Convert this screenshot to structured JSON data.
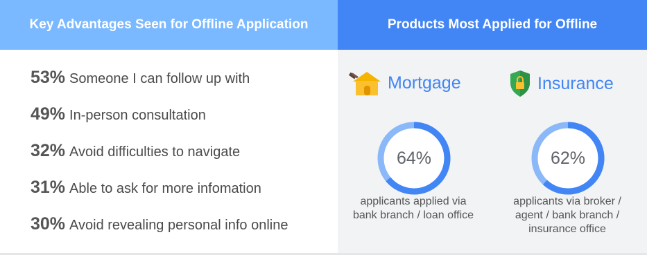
{
  "headers": {
    "left": "Key Advantages Seen for Offline Application",
    "right": "Products Most Applied for Offline"
  },
  "advantages": [
    {
      "pct": "53%",
      "text": "Someone I can follow up with"
    },
    {
      "pct": "49%",
      "text": "In-person consultation"
    },
    {
      "pct": "32%",
      "text": "Avoid difficulties to navigate"
    },
    {
      "pct": "31%",
      "text": "Able to ask for more infomation"
    },
    {
      "pct": "30%",
      "text": "Avoid revealing personal info online"
    }
  ],
  "products": [
    {
      "name": "Mortgage",
      "icon": "house-gavel-icon",
      "label": "64%",
      "caption": "applicants applied via bank branch / loan office"
    },
    {
      "name": "Insurance",
      "icon": "shield-lock-icon",
      "label": "62%",
      "caption": "applicants via broker / agent / bank branch / insurance office"
    }
  ],
  "colors": {
    "left_header": "#7ab8ff",
    "right_header": "#4285f4",
    "donut_fill": "#4285f4",
    "donut_track": "#8ab8f8"
  },
  "chart_data": [
    {
      "type": "bar",
      "title": "Key Advantages Seen for Offline Application",
      "categories": [
        "Someone I can follow up with",
        "In-person consultation",
        "Avoid difficulties to navigate",
        "Able to ask for more infomation",
        "Avoid revealing personal info online"
      ],
      "values": [
        53,
        49,
        32,
        31,
        30
      ]
    },
    {
      "type": "pie",
      "title": "Products Most Applied for Offline",
      "categories": [
        "Mortgage",
        "Insurance"
      ],
      "values": [
        64,
        62
      ]
    }
  ]
}
